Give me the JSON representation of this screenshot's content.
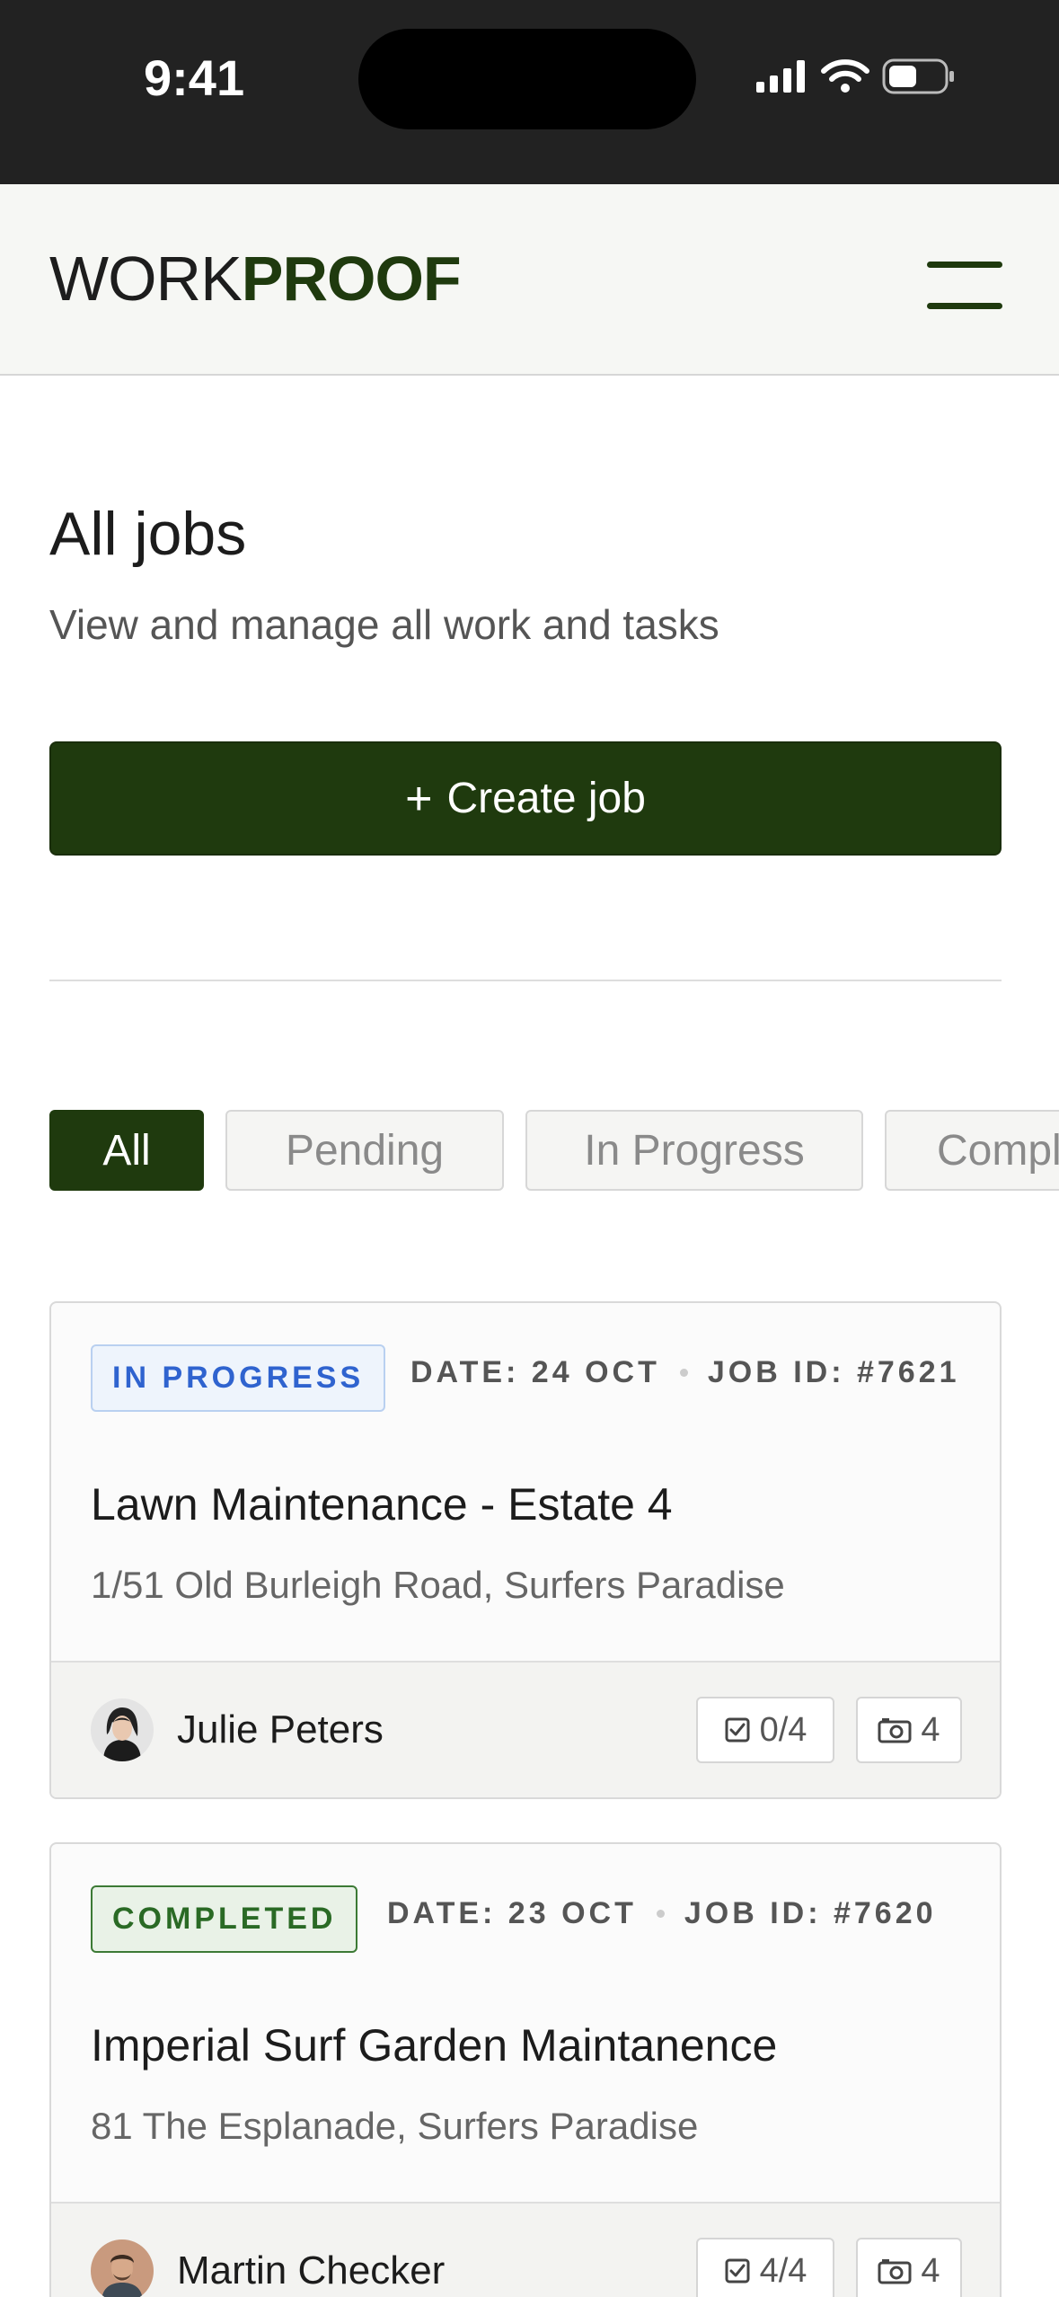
{
  "status_bar": {
    "time": "9:41"
  },
  "header": {
    "logo_light": "WORK",
    "logo_bold": "PROOF"
  },
  "page": {
    "title": "All jobs",
    "subtitle": "View and manage all work and tasks",
    "create_button": {
      "icon": "plus-icon",
      "label": "Create job"
    }
  },
  "filters": {
    "tabs": [
      {
        "label": "All",
        "active": true
      },
      {
        "label": "Pending",
        "active": false
      },
      {
        "label": "In Progress",
        "active": false
      },
      {
        "label": "Completed",
        "active": false
      }
    ]
  },
  "jobs": [
    {
      "status": "IN PROGRESS",
      "date": "DATE: 24 OCT",
      "job_id": "JOB ID: #7621",
      "title": "Lawn Maintenance - Estate 4",
      "address": "1/51 Old Burleigh Road, Surfers Paradise",
      "assignee": "Julie Peters",
      "tasks": "0/4",
      "photos": "4"
    },
    {
      "status": "COMPLETED",
      "date": "DATE: 23 OCT",
      "job_id": "JOB ID: #7620",
      "title": "Imperial Surf Garden Maintanence",
      "address": "81 The Esplanade, Surfers Paradise",
      "assignee": "Martin Checker",
      "tasks": "4/4",
      "photos": "4"
    }
  ],
  "colors": {
    "brand": "#1f3a0e",
    "in_progress": "#2f63cf",
    "completed": "#2a6a25"
  }
}
